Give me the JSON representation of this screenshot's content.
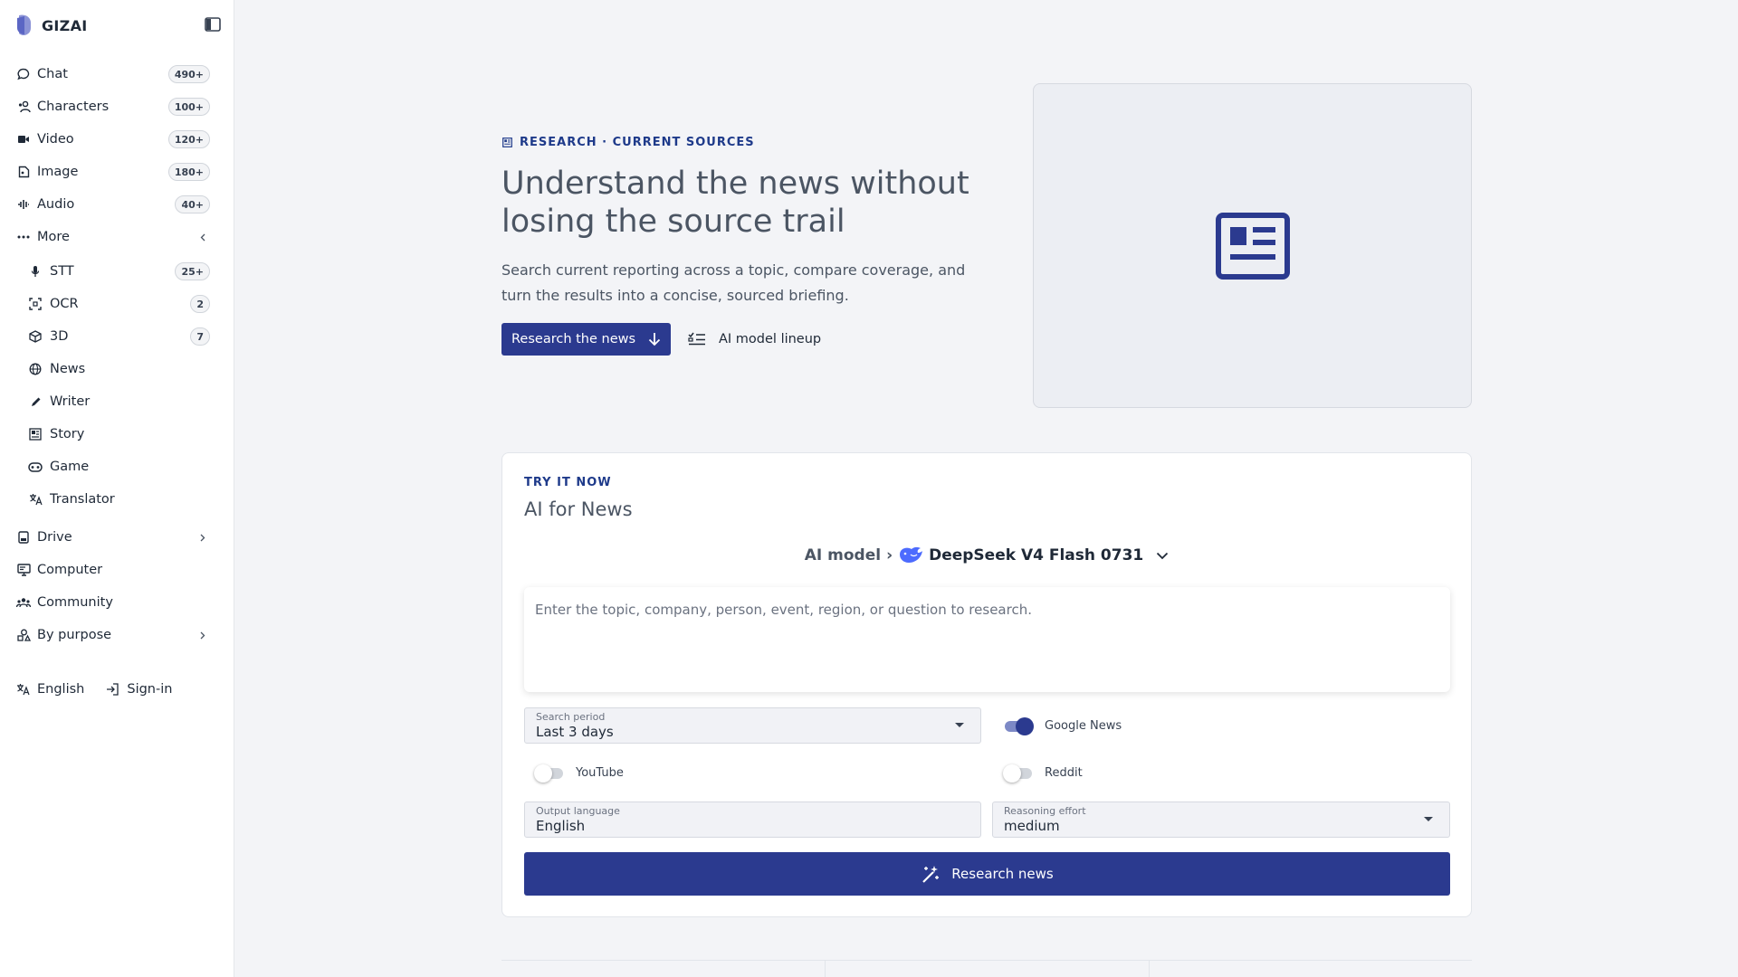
{
  "brand": {
    "name": "GIZAI",
    "logo": "gizai-logo"
  },
  "sidebar": {
    "collapse_icon": "sidebar-toggle-icon",
    "items": [
      {
        "label": "Chat",
        "badge": "490+",
        "icon": "chat-icon"
      },
      {
        "label": "Characters",
        "badge": "100+",
        "icon": "characters-icon"
      },
      {
        "label": "Video",
        "badge": "120+",
        "icon": "video-icon"
      },
      {
        "label": "Image",
        "badge": "180+",
        "icon": "image-icon"
      },
      {
        "label": "Audio",
        "badge": "40+",
        "icon": "audio-icon"
      },
      {
        "label": "More",
        "icon": "more-icon",
        "chevron": "chevron-left-icon"
      }
    ],
    "sub_items": [
      {
        "label": "STT",
        "badge": "25+",
        "icon": "microphone-icon"
      },
      {
        "label": "OCR",
        "badge": "2",
        "icon": "ocr-icon"
      },
      {
        "label": "3D",
        "badge": "7",
        "icon": "cube-icon"
      },
      {
        "label": "News",
        "icon": "globe-icon"
      },
      {
        "label": "Writer",
        "icon": "pen-icon"
      },
      {
        "label": "Story",
        "icon": "story-icon"
      },
      {
        "label": "Game",
        "icon": "gamepad-icon"
      },
      {
        "label": "Translator",
        "icon": "translate-icon"
      }
    ],
    "lower_items": [
      {
        "label": "Drive",
        "icon": "drive-icon",
        "chevron": "chevron-right-icon"
      },
      {
        "label": "Computer",
        "icon": "computer-icon"
      },
      {
        "label": "Community",
        "icon": "community-icon"
      },
      {
        "label": "By purpose",
        "icon": "purpose-icon",
        "chevron": "chevron-right-icon"
      }
    ],
    "footer": {
      "language": "English",
      "signin": "Sign-in"
    }
  },
  "hero": {
    "eyebrow": "RESEARCH · CURRENT SOURCES",
    "title": "Understand the news without losing the source trail",
    "description": "Search current reporting across a topic, compare coverage, and turn the results into a concise, sourced briefing.",
    "primary_button": "Research the news",
    "secondary_link": "AI model lineup",
    "card_icon": "newspaper-icon"
  },
  "panel": {
    "eyebrow": "TRY IT NOW",
    "title": "AI for News",
    "model_label": "AI model",
    "model_separator": "›",
    "model_name": "DeepSeek V4 Flash 0731",
    "model_icon": "deepseek-whale-icon",
    "prompt_placeholder": "Enter the topic, company, person, event, region, or question to research.",
    "search_period": {
      "caption": "Search period",
      "value": "Last 3 days"
    },
    "toggles": [
      {
        "label": "Google News",
        "on": true
      },
      {
        "label": "YouTube",
        "on": false
      },
      {
        "label": "Reddit",
        "on": false
      }
    ],
    "output_language": {
      "caption": "Output language",
      "value": "English"
    },
    "reasoning_effort": {
      "caption": "Reasoning effort",
      "value": "medium"
    },
    "submit": "Research news"
  },
  "colors": {
    "accent": "#2b3a8f",
    "eyebrow": "#1e3a8a",
    "background": "#f3f4f7"
  }
}
